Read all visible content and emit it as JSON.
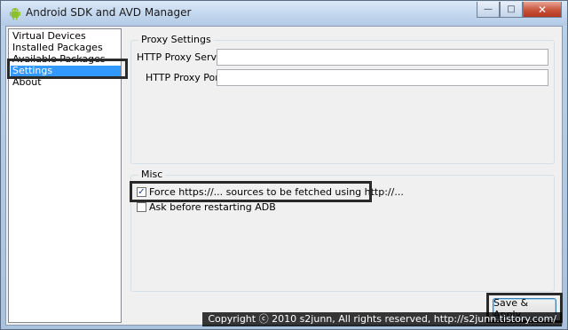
{
  "window": {
    "title": "Android SDK and AVD Manager",
    "controls": {
      "minimize": "—",
      "maximize": "□",
      "close": "✕"
    }
  },
  "sidebar": {
    "items": [
      {
        "label": "Virtual Devices",
        "selected": false
      },
      {
        "label": "Installed Packages",
        "selected": false
      },
      {
        "label": "Available Packages",
        "selected": false
      },
      {
        "label": "Settings",
        "selected": true
      },
      {
        "label": "About",
        "selected": false
      }
    ]
  },
  "settings": {
    "proxy": {
      "legend": "Proxy Settings",
      "server_label": "HTTP Proxy Server",
      "server_value": "",
      "port_label": "HTTP Proxy Port",
      "port_value": ""
    },
    "misc": {
      "legend": "Misc",
      "force_https_label": "Force https://... sources to be fetched using http://...",
      "force_https_checked": true,
      "ask_restart_label": "Ask before restarting ADB",
      "ask_restart_checked": false
    },
    "save_button": "Save & Apply"
  },
  "icons": {
    "app": "android-icon",
    "check": "✓"
  },
  "colors": {
    "selection": "#3399ff",
    "highlight_box": "#2a2a2a"
  },
  "watermark": "Copyright ⓒ 2010 s2junn, All rights reserved, http://s2junn.tistory.com/"
}
